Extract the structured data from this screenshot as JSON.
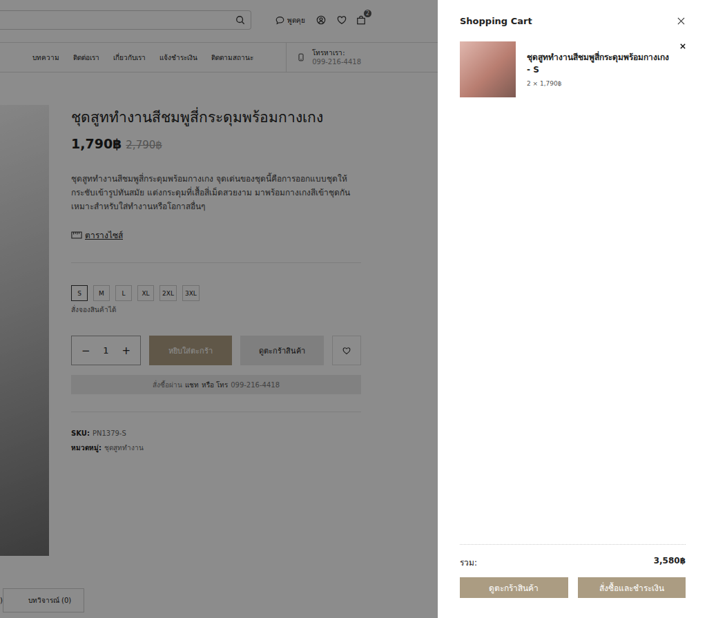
{
  "header": {
    "chat_label": "พูดคุย",
    "cart_count": "2"
  },
  "nav": {
    "items": [
      "บทความ",
      "ติดต่อเรา",
      "เกี่ยวกับเรา",
      "แจ้งชำระเงิน",
      "ติดตามสถานะ"
    ],
    "phone_label": "โทรหาเรา:",
    "phone": "099-216-4418"
  },
  "product": {
    "title": "ชุดสูททำงานสีชมพูสี่กระดุมพร้อมกางเกง",
    "price": "1,790฿",
    "old_price": "2,790฿",
    "description": "ชุดสูททำงานสีชมพูสี่กระดุมพร้อมกางเกง จุดเด่นของชุดนี้คือการออกแบบชุดให้กระชับเข้ารูปทันสมัย แต่งกระดุมที่เสื้อสี่เม็ดสวยงาม มาพร้อมกางเกงสีเข้าชุดกัน เหมาะสำหรับใส่ทำงานหรือโอกาสอื่นๆ",
    "size_chart_label": "ตารางไซส์",
    "sizes": [
      {
        "label": "S",
        "selected": true
      },
      {
        "label": "M",
        "selected": false
      },
      {
        "label": "L",
        "selected": false
      },
      {
        "label": "XL",
        "selected": false
      },
      {
        "label": "2XL",
        "selected": false
      },
      {
        "label": "3XL",
        "selected": false
      }
    ],
    "stock_note": "สั่งจองสินค้าได้",
    "qty_minus": "−",
    "quantity": "1",
    "qty_plus": "+",
    "add_to_cart": "หยิบใส่ตะกร้า",
    "view_cart": "ดูตะกร้าสินค้า",
    "order_note": {
      "prefix": "สั่งซื้อผ่าน",
      "chat": "แชท",
      "middle": "หรือ โทร",
      "phone": "099-216-4418"
    },
    "sku_label": "SKU:",
    "sku": "PN1379-S",
    "category_label": "หมวดหมู่:",
    "category": "ชุดสูททำงาน"
  },
  "tabs": [
    {
      "label": ")",
      "selected": false
    },
    {
      "label": "บทวิจารณ์ (0)",
      "selected": false
    }
  ],
  "cart": {
    "title": "Shopping Cart",
    "items": [
      {
        "name": "ชุดสูททำงานสีชมพูสี่กระดุมพร้อมกางเกง - S",
        "quantity_price": "2 × 1,790฿"
      }
    ],
    "subtotal_label": "รวม:",
    "subtotal": "3,580฿",
    "view_cart": "ดูตะกร้าสินค้า",
    "checkout": "สั่งซื้อและชำระเงิน"
  }
}
